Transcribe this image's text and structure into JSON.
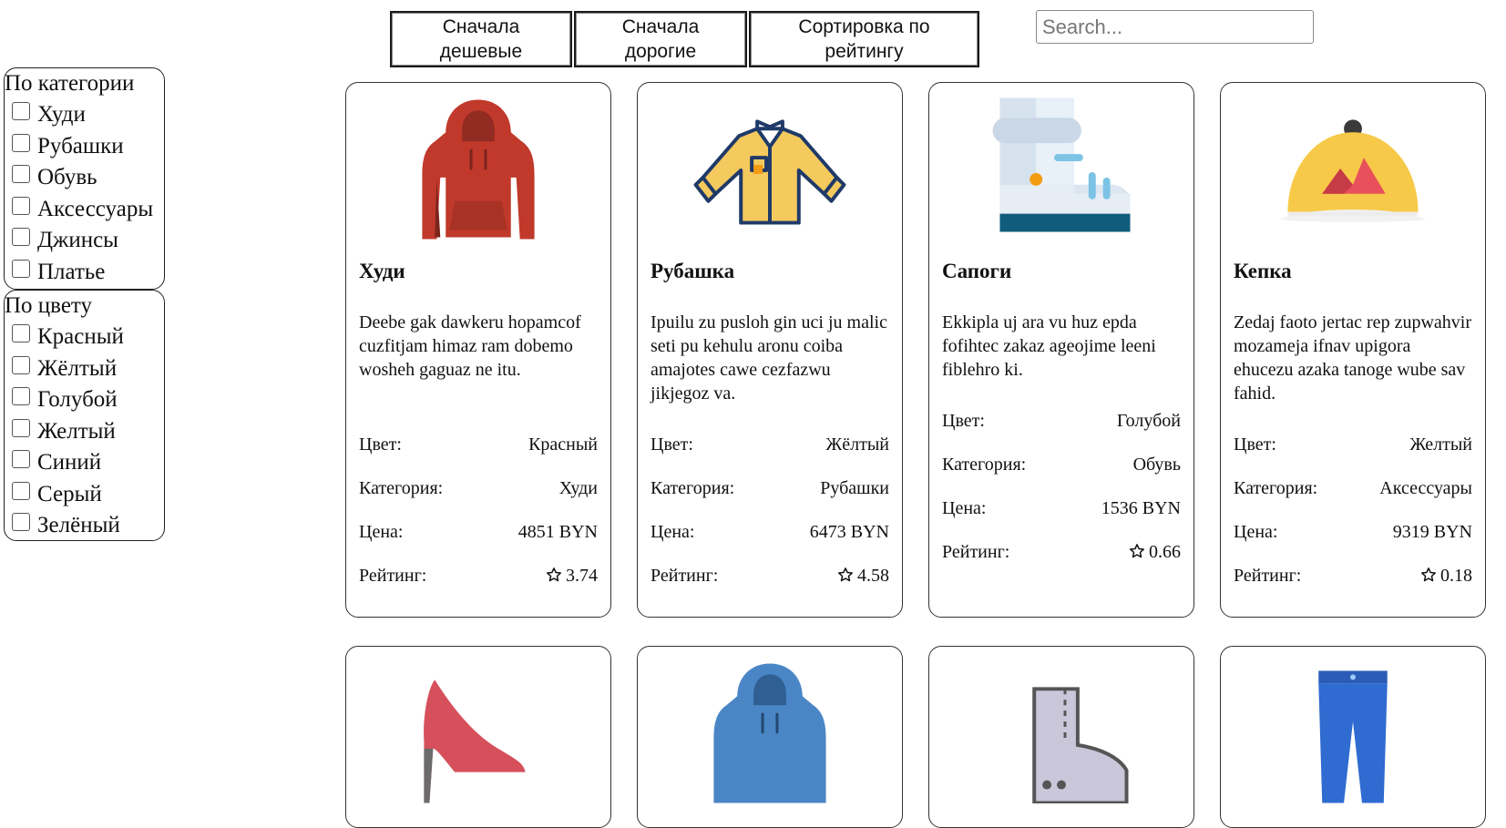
{
  "sort": {
    "cheap_first": "Сначала дешевые",
    "expensive_first": "Сначала дорогие",
    "by_rating": "Сортировка по рейтингу"
  },
  "search": {
    "placeholder": "Search...",
    "value": ""
  },
  "filters": {
    "category": {
      "title": "По категории",
      "options": [
        "Худи",
        "Рубашки",
        "Обувь",
        "Аксессуары",
        "Джинсы",
        "Платье"
      ]
    },
    "color": {
      "title": "По цвету",
      "options": [
        "Красный",
        "Жёлтый",
        "Голубой",
        "Желтый",
        "Синий",
        "Серый",
        "Зелёный"
      ]
    }
  },
  "labels": {
    "color": "Цвет:",
    "category": "Категория:",
    "price": "Цена:",
    "rating": "Рейтинг:"
  },
  "products": [
    {
      "name": "Худи",
      "description": "Deebe gak dawkeru hopamcof cuzfitjam himaz ram dobemo wosheh gaguaz ne itu.",
      "color": "Красный",
      "category": "Худи",
      "price": "4851 BYN",
      "rating": "3.74",
      "icon": "red-hoodie-icon"
    },
    {
      "name": "Рубашка",
      "description": "Ipuilu zu pusloh gin uci ju malic seti pu kehulu aronu coiba amajotes cawe cezfazwu jikjegoz va.",
      "color": "Жёлтый",
      "category": "Рубашки",
      "price": "6473 BYN",
      "rating": "4.58",
      "icon": "yellow-shirt-icon"
    },
    {
      "name": "Сапоги",
      "description": "Ekkipla uj ara vu huz epda fofihtec zakaz ageojime leeni fiblehro ki.",
      "color": "Голубой",
      "category": "Обувь",
      "price": "1536 BYN",
      "rating": "0.66",
      "icon": "boot-icon"
    },
    {
      "name": "Кепка",
      "description": "Zedaj faoto jertac rep zupwahvir mozameja ifnav upigora ehucezu azaka tanoge wube sav fahid.",
      "color": "Желтый",
      "category": "Аксессуары",
      "price": "9319 BYN",
      "rating": "0.18",
      "icon": "yellow-cap-icon"
    }
  ],
  "next_row_icons": [
    "high-heel-icon",
    "blue-hoodie-icon",
    "gray-boot-icon",
    "jeans-icon"
  ]
}
